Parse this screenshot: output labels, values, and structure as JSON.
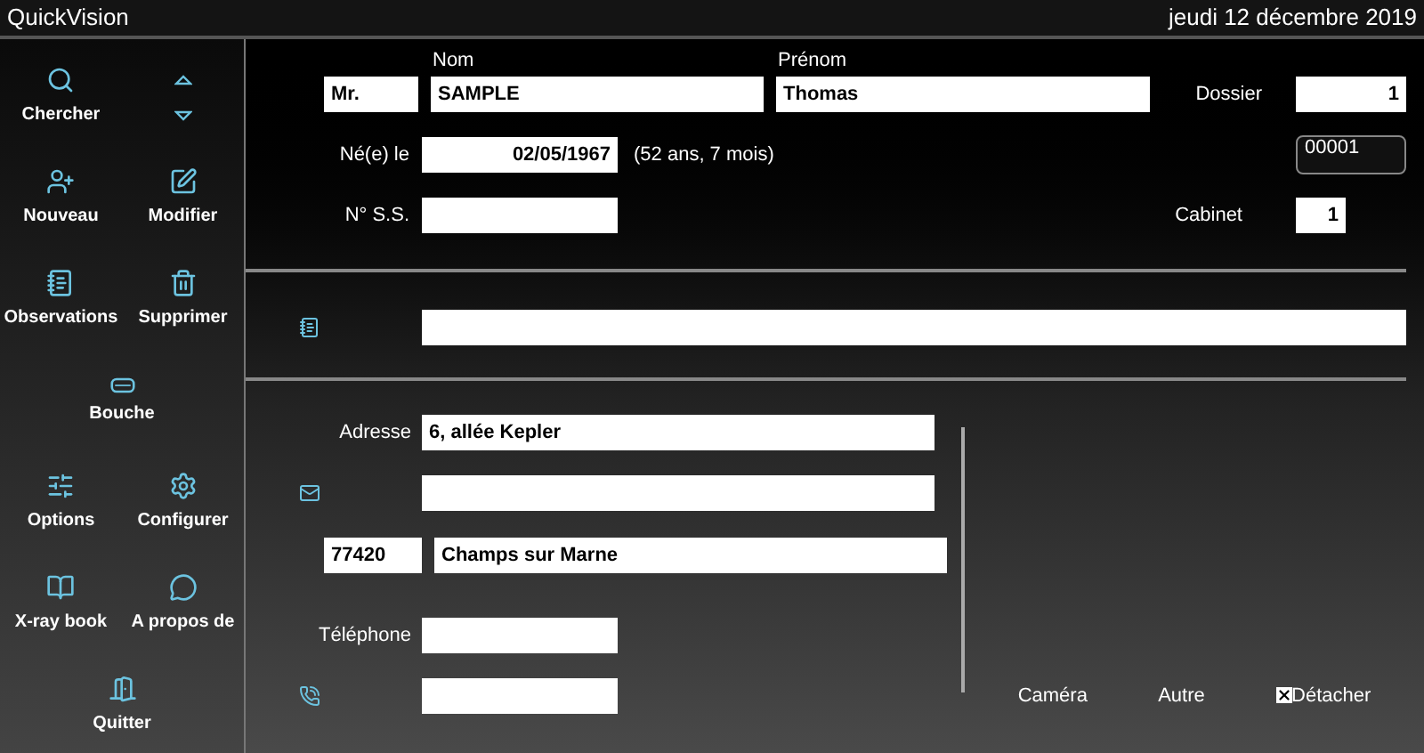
{
  "window": {
    "title": "QuickVision",
    "date": "jeudi 12 décembre 2019"
  },
  "sidebar": {
    "items": [
      {
        "label": "Chercher"
      },
      {
        "label": "Nouveau"
      },
      {
        "label": "Modifier"
      },
      {
        "label": "Observations"
      },
      {
        "label": "Supprimer"
      },
      {
        "label": "Bouche"
      },
      {
        "label": "Options"
      },
      {
        "label": "Configurer"
      },
      {
        "label": "X-ray book"
      },
      {
        "label": "A propos de"
      },
      {
        "label": "Quitter"
      }
    ]
  },
  "patient": {
    "nom_label": "Nom",
    "prenom_label": "Prénom",
    "civilite": "Mr.",
    "nom": "SAMPLE",
    "prenom": "Thomas",
    "dossier_label": "Dossier",
    "dossier": "1",
    "naissance_label": "Né(e) le",
    "naissance": "02/05/1967",
    "age": "(52 ans, 7 mois)",
    "code": "00001",
    "ss_label": "N° S.S.",
    "cabinet_label": "Cabinet",
    "cabinet": "1"
  },
  "address": {
    "adresse_label": "Adresse",
    "adresse": "6, allée Kepler",
    "code_postal": "77420",
    "ville": "Champs sur Marne",
    "telephone_label": "Téléphone"
  },
  "bottom": {
    "camera": "Caméra",
    "autre": "Autre",
    "detacher": {
      "label": "Détacher",
      "checked": true
    }
  }
}
